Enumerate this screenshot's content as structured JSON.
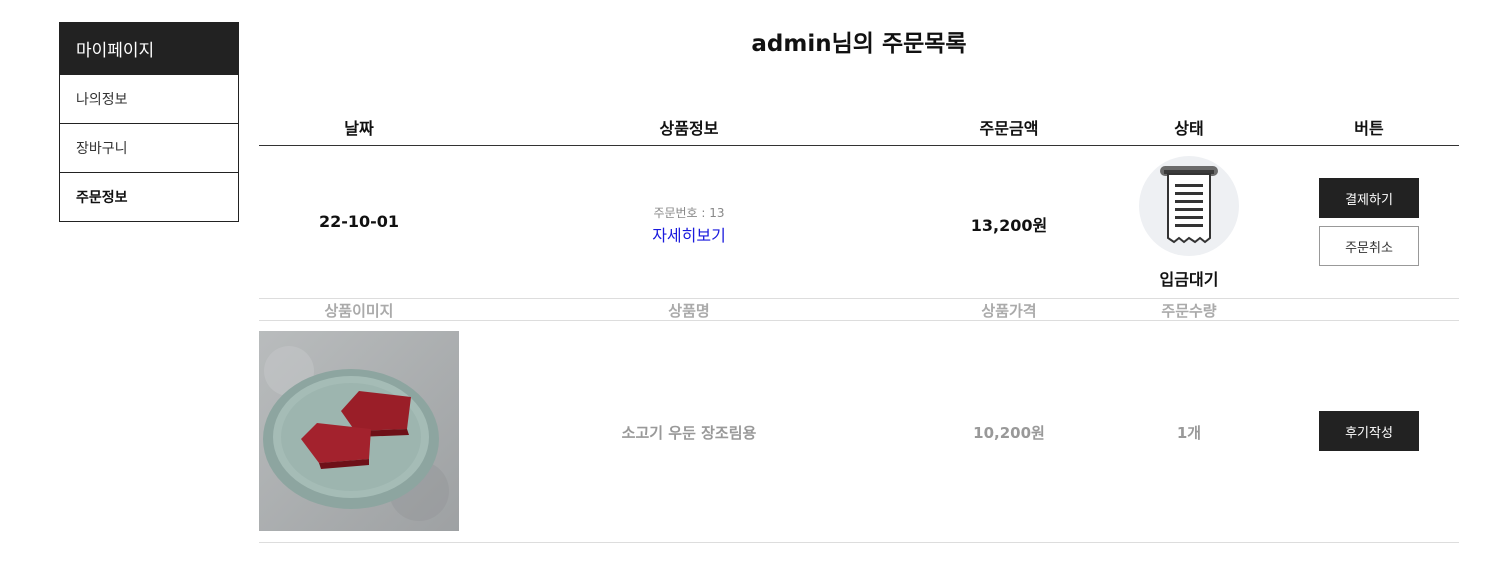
{
  "sidebar": {
    "title": "마이페이지",
    "items": [
      {
        "label": "나의정보"
      },
      {
        "label": "장바구니"
      },
      {
        "label": "주문정보"
      }
    ]
  },
  "page_title": "admin님의 주문목록",
  "order_table": {
    "headers": [
      "날짜",
      "상품정보",
      "주문금액",
      "상태",
      "버튼"
    ],
    "row": {
      "date": "22-10-01",
      "order_no": "주문번호 : 13",
      "detail_link": "자세히보기",
      "amount": "13,200원",
      "status_icon": "receipt-icon",
      "status": "입금대기",
      "pay_button": "결제하기",
      "cancel_button": "주문취소"
    }
  },
  "product_table": {
    "headers": [
      "상품이미지",
      "상품명",
      "상품가격",
      "주문수량"
    ],
    "rows": [
      {
        "image": "beef-on-plate-photo",
        "name": "소고기 우둔 장조림용",
        "price": "10,200원",
        "qty": "1개",
        "review_button": "후기작성"
      }
    ]
  },
  "colors": {
    "dark": "#222222",
    "link": "#1a1add",
    "muted": "#999999",
    "status_bg": "#eef0f3"
  }
}
